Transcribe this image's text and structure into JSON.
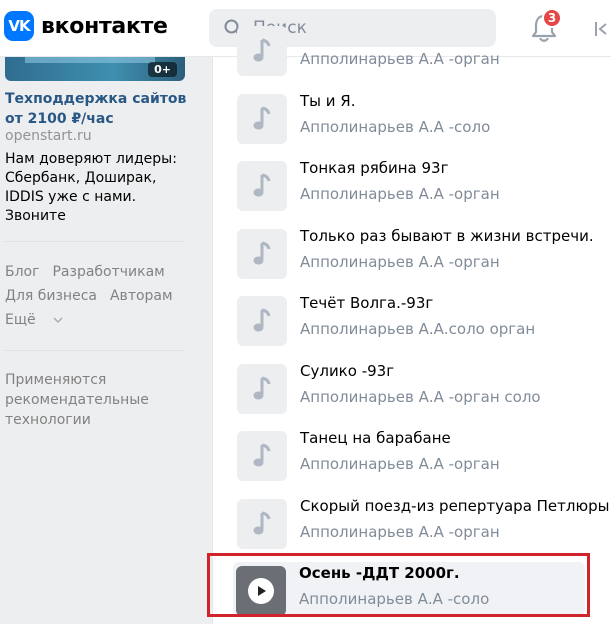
{
  "header": {
    "logo_mark": "VK",
    "logo_text": "вконтакте",
    "search_placeholder": "Поиск",
    "notifications_count": "3"
  },
  "sidebar": {
    "ad": {
      "image_badge": "0+",
      "title": "Техподдержка сайтов от 2100 ₽/час",
      "domain": "openstart.ru",
      "description": "Нам доверяют лидеры: Сбербанк, Доширак, IDDIS уже с нами. Звоните"
    },
    "footer_links": [
      "Блог",
      "Разработчикам",
      "Для бизнеса",
      "Авторам"
    ],
    "more_label": "Ещё",
    "recommend_text": "Применяются рекомендательные технологии"
  },
  "tracks": [
    {
      "title": "",
      "artist": "Апполинарьев А.А -орган"
    },
    {
      "title": "Ты и Я.",
      "artist": "Апполинарьев А.А -соло"
    },
    {
      "title": "Тонкая рябина 93г",
      "artist": "Апполинарьев А.А -орган"
    },
    {
      "title": "Только раз бывают в жизни встречи.",
      "artist": "Апполинарьев А.А -орган"
    },
    {
      "title": "Течёт Волга.-93г",
      "artist": "Апполинарьев А.А.соло орган"
    },
    {
      "title": "Сулико -93г",
      "artist": "Апполинарьев А.А -орган соло"
    },
    {
      "title": "Танец на барабане",
      "artist": "Апполинарьев А.А -орган"
    },
    {
      "title": "Скорый поезд-из репертуара Петлюры",
      "artist": "Апполинарьев А.А -орган"
    },
    {
      "title": "Осень -ДДТ 2000г.",
      "artist": "Апполинарьев А.А -соло"
    }
  ],
  "colors": {
    "accent": "#0077ff",
    "link": "#2a5885",
    "secondary_text": "#818c99",
    "badge": "#e64646",
    "highlight_box": "#d0232b"
  },
  "icons": {
    "search": "search-icon",
    "notifications": "bell-icon",
    "note": "music-note-icon",
    "play": "play-icon"
  }
}
